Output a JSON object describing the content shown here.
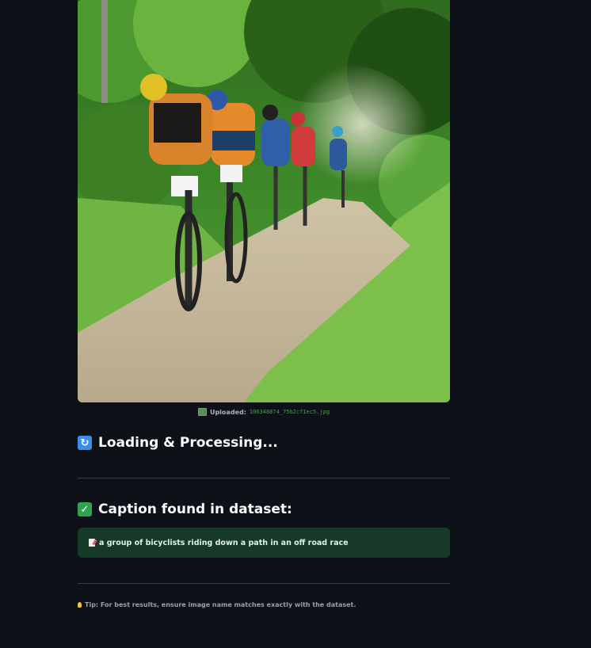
{
  "upload": {
    "label": "Uploaded:",
    "filename": "106348874_75b2cf1ec5.jpg",
    "image_alt": "Mountain bike racers riding on a dirt forest path"
  },
  "loading": {
    "title": "Loading & Processing...",
    "icon": "refresh-icon"
  },
  "result": {
    "title": "Caption found in dataset:",
    "icon": "check-icon",
    "caption": "a group of bicyclists riding down a path in an off road race",
    "caption_icon": "memo-icon"
  },
  "tip": {
    "text": "Tip: For best results, ensure image name matches exactly with the dataset.",
    "icon": "bulb-icon"
  },
  "colors": {
    "background": "#0e1117",
    "success_bg": "#173928",
    "accent_green": "#30a352",
    "accent_blue": "#3b8eea"
  }
}
